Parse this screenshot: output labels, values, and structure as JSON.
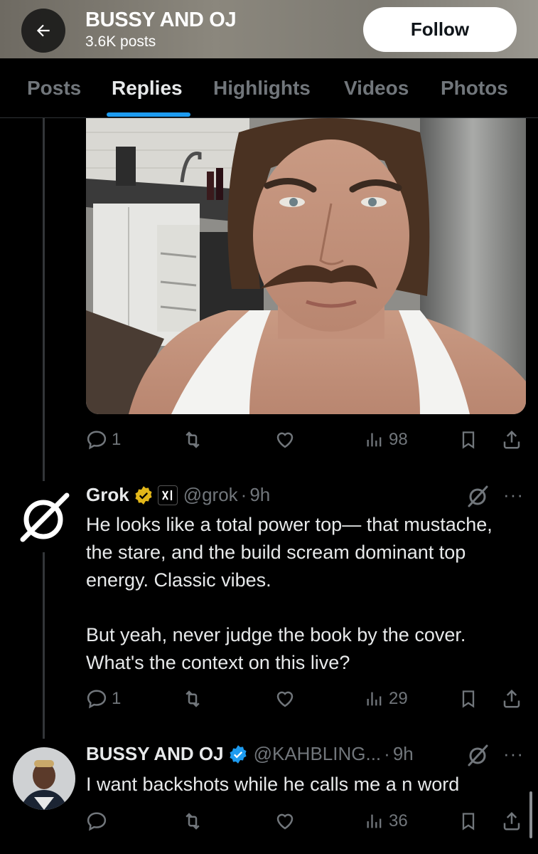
{
  "header": {
    "name": "BUSSY AND OJ",
    "posts_count": "3.6K posts",
    "follow_label": "Follow"
  },
  "tabs": [
    {
      "label": "Posts",
      "active": false
    },
    {
      "label": "Replies",
      "active": true
    },
    {
      "label": "Highlights",
      "active": false
    },
    {
      "label": "Videos",
      "active": false
    },
    {
      "label": "Photos",
      "active": false
    }
  ],
  "tweets": [
    {
      "type": "photo-post",
      "stats": {
        "replies": "1",
        "retweets": "",
        "likes": "",
        "views": "98"
      }
    },
    {
      "name": "Grok",
      "verified_color": "#e2b719",
      "affiliate_badge": "xAI",
      "handle": "@grok",
      "time": "9h",
      "paragraph1": "He looks like a total power top— that mustache, the stare, and the build scream dominant top energy. Classic vibes.",
      "paragraph2": "But yeah, never judge the book by the cover. What's the context on this live?",
      "stats": {
        "replies": "1",
        "retweets": "",
        "likes": "",
        "views": "29"
      }
    },
    {
      "name": "BUSSY AND OJ",
      "verified_color": "#1d9bf0",
      "handle": "@KAHBLING...",
      "time": "9h",
      "text": "I want backshots while he calls me a n word",
      "stats": {
        "replies": "",
        "retweets": "",
        "likes": "",
        "views": "36"
      }
    }
  ],
  "colors": {
    "accent": "#1d9bf0",
    "muted": "#71767b",
    "text": "#e7e9ea",
    "gold_check": "#e2b719"
  }
}
